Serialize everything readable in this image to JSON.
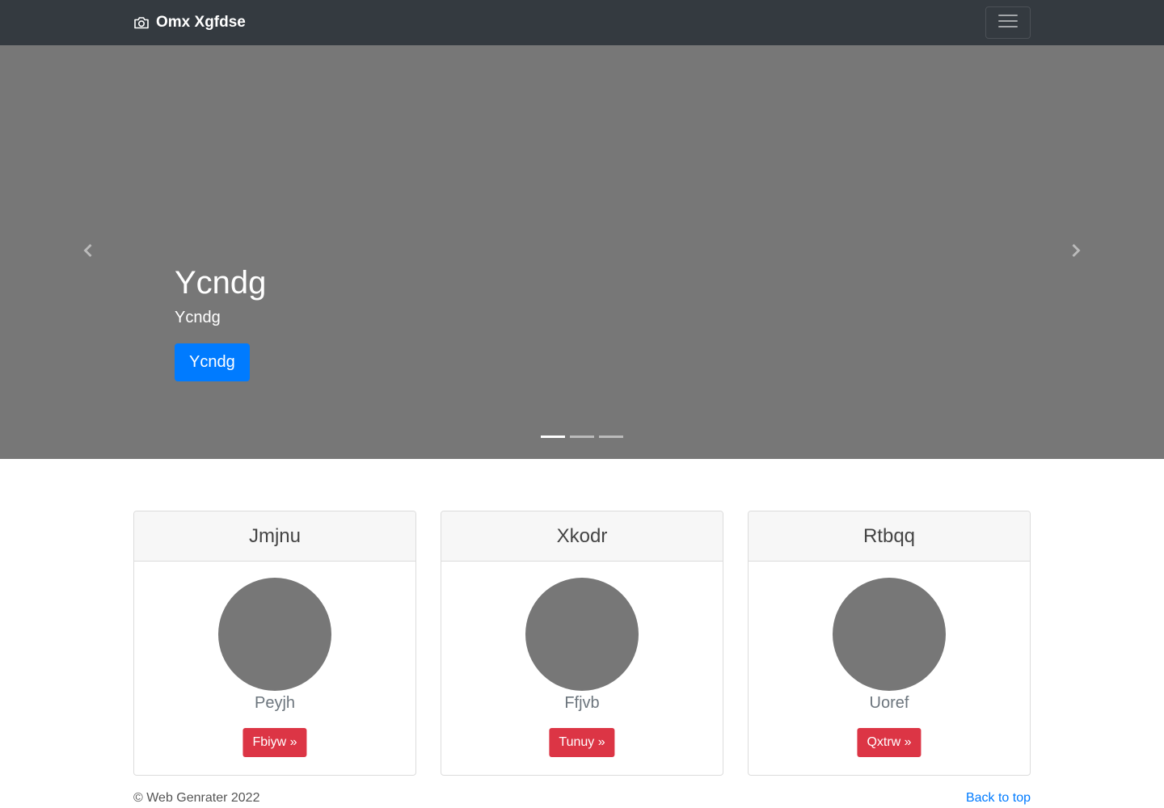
{
  "navbar": {
    "brand": "Omx Xgfdse",
    "brand_icon": "camera-icon",
    "toggler_icon": "hamburger-menu-icon"
  },
  "carousel": {
    "title": "Ycndg",
    "subtitle": "Ycndg",
    "button_label": "Ycndg",
    "prev_icon": "chevron-left-icon",
    "next_icon": "chevron-right-icon",
    "indicator_count": 3,
    "active_indicator": 0,
    "background_color": "#777777"
  },
  "cards": [
    {
      "header": "Jmjnu",
      "text": "Peyjh",
      "button_label": "Fbiyw »"
    },
    {
      "header": "Xkodr",
      "text": "Ffjvb",
      "button_label": "Tunuy »"
    },
    {
      "header": "Rtbqq",
      "text": "Uoref",
      "button_label": "Qxtrw »"
    }
  ],
  "footer": {
    "copyright": "© Web Genrater 2022",
    "back_to_top": "Back to top"
  },
  "colors": {
    "navbar": "#343a40",
    "primary": "#007bff",
    "danger": "#dc3545",
    "placeholder": "#777777"
  }
}
